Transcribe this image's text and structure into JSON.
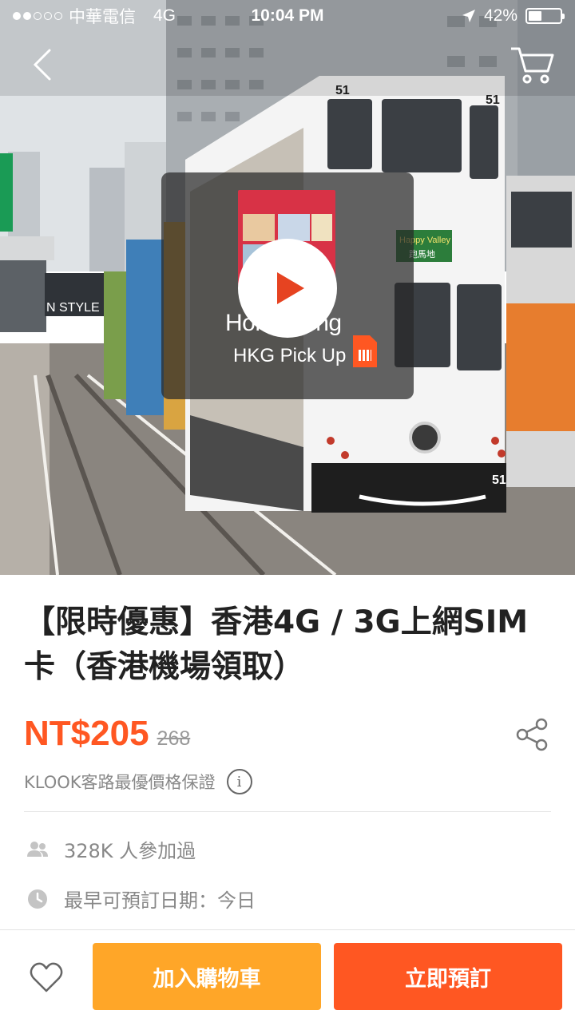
{
  "status_bar": {
    "carrier": "中華電信",
    "network": "4G",
    "time": "10:04 PM",
    "battery_text": "42%",
    "battery_level": 0.42,
    "signal_bars_filled": 2,
    "signal_bars_total": 5,
    "location_icon": "location-arrow-icon"
  },
  "nav": {
    "back_icon": "chevron-left-icon",
    "cart_icon": "cart-icon"
  },
  "hero": {
    "tram_route": "51",
    "tram_sign": "Happy Valley",
    "tram_sign_cn": "跑馬地",
    "storefront_text": "N STYLE",
    "video": {
      "title": "Hong Kong",
      "subtitle": "HKG Pick Up",
      "play_icon": "play-icon",
      "sim_icon": "sim-card-icon"
    }
  },
  "product": {
    "title": "【限時優惠】香港4G / 3G上網SIM卡（香港機場領取）",
    "price": "NT$205",
    "original_price": "268",
    "share_icon": "share-icon",
    "guarantee": "KLOOK客路最優價格保證",
    "info_icon": "info-icon",
    "participants": "328K 人參加過",
    "participants_icon": "people-icon",
    "earliest_date": "最早可預訂日期：今日",
    "clock_icon": "clock-icon"
  },
  "bottom_bar": {
    "wishlist_icon": "heart-icon",
    "add_to_cart": "加入購物車",
    "book_now": "立即預訂"
  },
  "colors": {
    "accent": "#ff5722",
    "cart_button": "#ffa628",
    "muted_text": "#888888"
  }
}
